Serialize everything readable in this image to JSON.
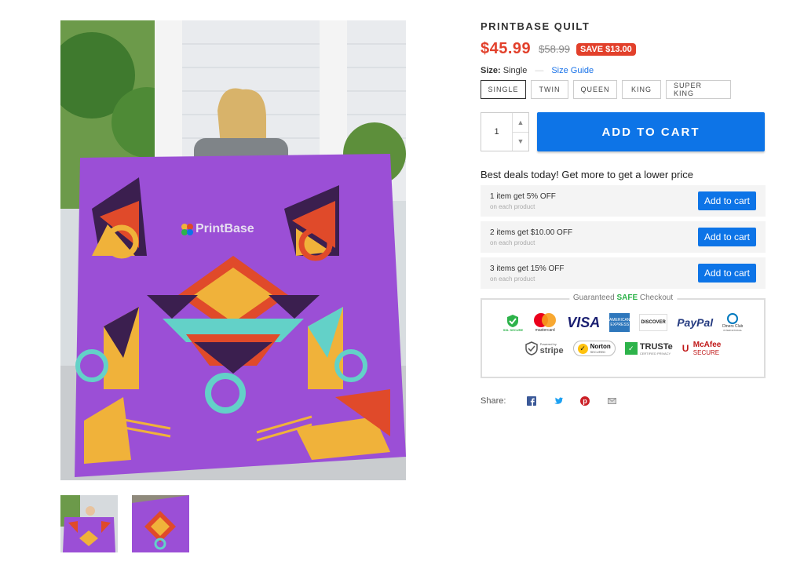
{
  "product": {
    "title": "PRINTBASE QUILT",
    "price": "$45.99",
    "compare_price": "$58.99",
    "save_badge": "SAVE $13.00",
    "image_brand": "PrintBase"
  },
  "size": {
    "label": "Size:",
    "selected": "Single",
    "guide": "Size Guide",
    "options": [
      "SINGLE",
      "TWIN",
      "QUEEN",
      "KING",
      "SUPER KING"
    ]
  },
  "cart": {
    "quantity": "1",
    "add_label": "ADD TO CART"
  },
  "deals": {
    "title": "Best deals today! Get more to get a lower price",
    "items": [
      {
        "main": "1 item get 5% OFF",
        "sub": "on each product",
        "button": "Add to cart"
      },
      {
        "main": "2 items get $10.00 OFF",
        "sub": "on each product",
        "button": "Add to cart"
      },
      {
        "main": "3 items get 15% OFF",
        "sub": "on each product",
        "button": "Add to cart"
      }
    ]
  },
  "secure": {
    "label_pre": "Guaranteed ",
    "label_safe": "SAFE",
    "label_post": " Checkout",
    "badges": {
      "ssl": "SSL SECURE",
      "mastercard": "mastercard",
      "visa": "VISA",
      "amex": "AMERICAN EXPRESS",
      "discover": "DISCOVER",
      "paypal": "PayPal",
      "diners": "Diners Club",
      "diners_sub": "INTERNATIONAL",
      "stripe_pre": "Powered by",
      "stripe": "stripe",
      "norton": "Norton",
      "norton_sub": "SECURED",
      "truste": "TRUSTe",
      "truste_sub": "CERTIFIED PRIVACY",
      "mcafee": "McAfee",
      "mcafee_sub": "SECURE"
    }
  },
  "share": {
    "label": "Share:",
    "icons": [
      "facebook-icon",
      "twitter-icon",
      "pinterest-icon",
      "email-icon"
    ]
  },
  "colors": {
    "accent": "#0d74e7",
    "price": "#e2402b",
    "quilt": "#9b4fd6"
  }
}
